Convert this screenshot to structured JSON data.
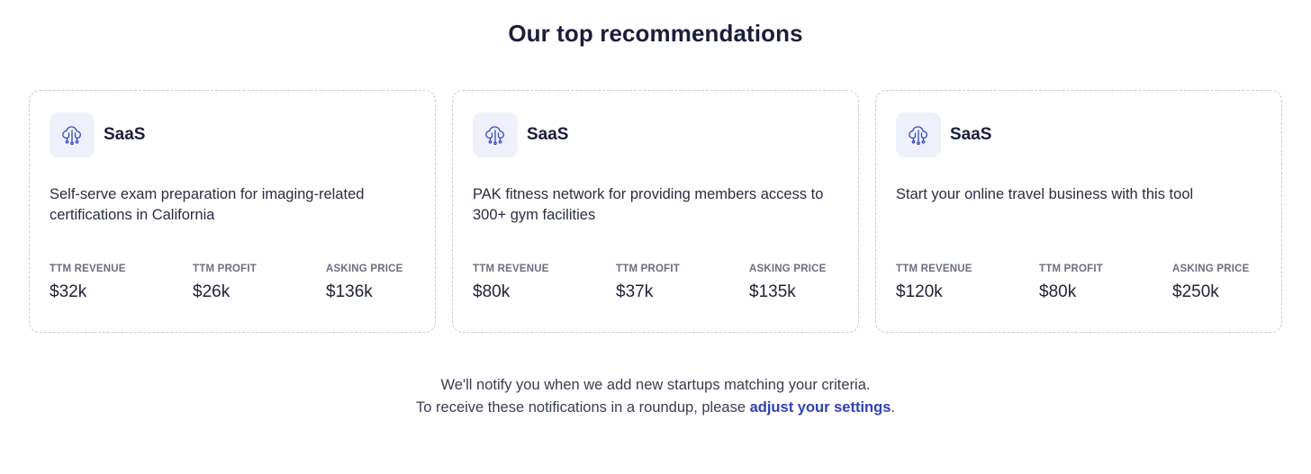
{
  "page": {
    "title": "Our top recommendations"
  },
  "cards": [
    {
      "icon": "cloud-chip-icon",
      "category": "SaaS",
      "description": "Self-serve exam preparation for imaging-related certifications in California",
      "metrics": [
        {
          "label": "TTM REVENUE",
          "value": "$32k"
        },
        {
          "label": "TTM PROFIT",
          "value": "$26k"
        },
        {
          "label": "ASKING PRICE",
          "value": "$136k"
        }
      ]
    },
    {
      "icon": "cloud-chip-icon",
      "category": "SaaS",
      "description": "PAK fitness network for providing members access to 300+ gym facilities",
      "metrics": [
        {
          "label": "TTM REVENUE",
          "value": "$80k"
        },
        {
          "label": "TTM PROFIT",
          "value": "$37k"
        },
        {
          "label": "ASKING PRICE",
          "value": "$135k"
        }
      ]
    },
    {
      "icon": "cloud-chip-icon",
      "category": "SaaS",
      "description": "Start your online travel business with this tool",
      "metrics": [
        {
          "label": "TTM REVENUE",
          "value": "$120k"
        },
        {
          "label": "TTM PROFIT",
          "value": "$80k"
        },
        {
          "label": "ASKING PRICE",
          "value": "$250k"
        }
      ]
    }
  ],
  "notice": {
    "line1": "We'll notify you when we add new startups matching your criteria.",
    "line2_prefix": "To receive these notifications in a roundup, please ",
    "link_text": "adjust your settings",
    "line2_suffix": "."
  },
  "colors": {
    "title": "#1a1d3d",
    "icon_bg": "#eef0fb",
    "icon_stroke": "#3447c4",
    "link": "#2f3fc0",
    "card_border": "#c9cbd3"
  }
}
